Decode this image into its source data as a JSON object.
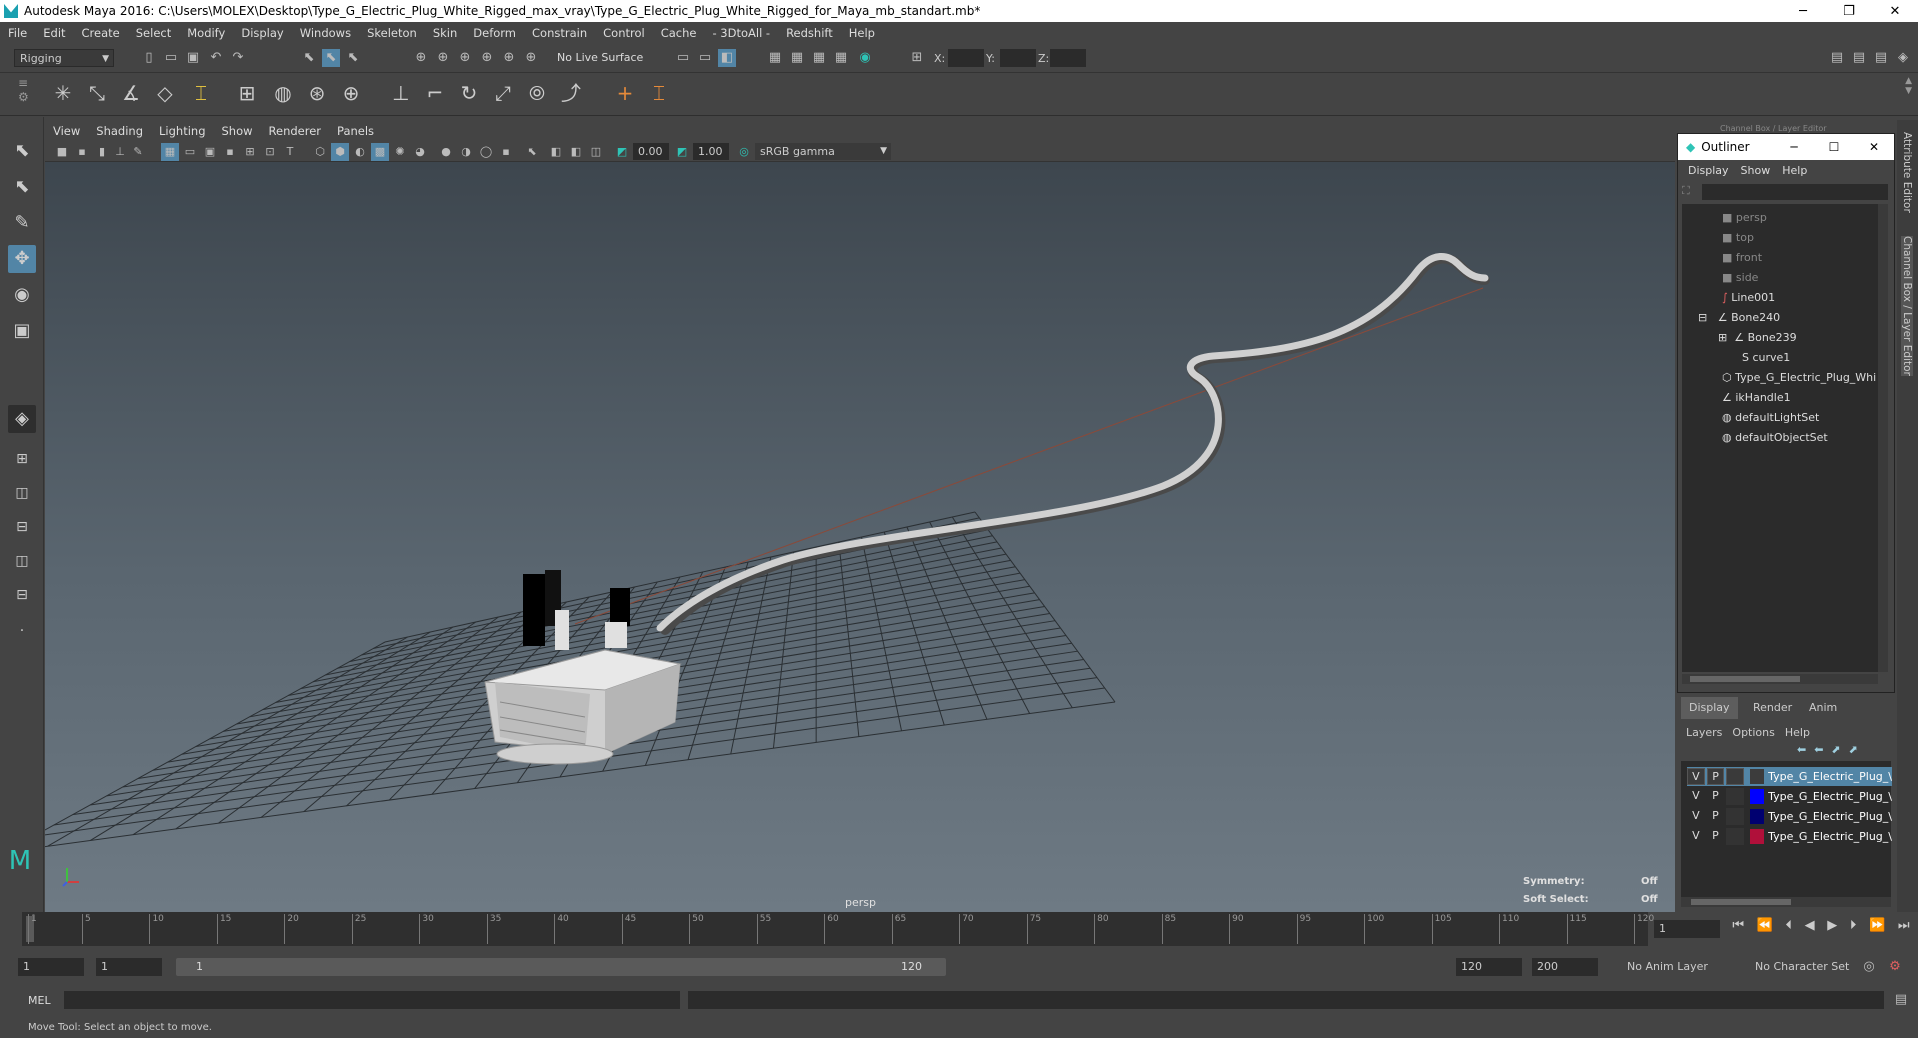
{
  "window": {
    "title": "Autodesk Maya 2016: C:\\Users\\MOLEX\\Desktop\\Type_G_Electric_Plug_White_Rigged_max_vray\\Type_G_Electric_Plug_White_Rigged_for_Maya_mb_standart.mb*",
    "minimize": "─",
    "restore": "❐",
    "close": "✕"
  },
  "menubar": [
    "File",
    "Edit",
    "Create",
    "Select",
    "Modify",
    "Display",
    "Windows",
    "Skeleton",
    "Skin",
    "Deform",
    "Constrain",
    "Control",
    "Cache",
    "- 3DtoAll -",
    "Redshift",
    "Help"
  ],
  "status_line": {
    "mode": "Rigging",
    "live_surface": "No Live Surface",
    "x_label": "X:",
    "y_label": "Y:",
    "z_label": "Z:"
  },
  "viewport": {
    "menu": [
      "View",
      "Shading",
      "Lighting",
      "Show",
      "Renderer",
      "Panels"
    ],
    "exposure": "0.00",
    "gamma": "1.00",
    "color_space": "sRGB gamma",
    "camera_label": "persp",
    "symmetry_label": "Symmetry:",
    "symmetry_value": "Off",
    "soft_select_label": "Soft Select:",
    "soft_select_value": "Off"
  },
  "channel_box_title": "Channel Box / Layer Editor",
  "outliner": {
    "title": "Outliner",
    "menu": [
      "Display",
      "Show",
      "Help"
    ],
    "items": [
      {
        "label": "persp",
        "dim": true
      },
      {
        "label": "top",
        "dim": true
      },
      {
        "label": "front",
        "dim": true
      },
      {
        "label": "side",
        "dim": true
      },
      {
        "label": "Line001",
        "dim": false
      },
      {
        "label": "Bone240",
        "dim": false
      },
      {
        "label": "Bone239",
        "dim": false
      },
      {
        "label": "curve1",
        "dim": false
      },
      {
        "label": "Type_G_Electric_Plug_Whi",
        "dim": false
      },
      {
        "label": "ikHandle1",
        "dim": false
      },
      {
        "label": "defaultLightSet",
        "dim": false
      },
      {
        "label": "defaultObjectSet",
        "dim": false
      }
    ]
  },
  "layer_editor": {
    "tabs": [
      "Display",
      "Render",
      "Anim"
    ],
    "menu": [
      "Layers",
      "Options",
      "Help"
    ],
    "layers": [
      {
        "v": "V",
        "p": "P",
        "name": "Type_G_Electric_Plug_\\",
        "color": "#3c3c3c"
      },
      {
        "v": "V",
        "p": "P",
        "name": "Type_G_Electric_Plug_\\",
        "color": "#0000ff"
      },
      {
        "v": "V",
        "p": "P",
        "name": "Type_G_Electric_Plug_\\",
        "color": "#000070"
      },
      {
        "v": "V",
        "p": "P",
        "name": "Type_G_Electric_Plug_\\",
        "color": "#b0103a"
      }
    ]
  },
  "side_tabs": [
    "Attribute Editor",
    "Channel Box / Layer Editor"
  ],
  "timeline": {
    "ticks": [
      "1",
      "5",
      "10",
      "15",
      "20",
      "25",
      "30",
      "35",
      "40",
      "45",
      "50",
      "55",
      "60",
      "65",
      "70",
      "75",
      "80",
      "85",
      "90",
      "95",
      "100",
      "105",
      "110",
      "115",
      "120"
    ],
    "current_frame": "1"
  },
  "range": {
    "start": "1",
    "playback_start": "1",
    "slider_start": "1",
    "slider_end": "120",
    "playback_end": "120",
    "end": "200",
    "anim_layer": "No Anim Layer",
    "character_set": "No Character Set"
  },
  "command_line": {
    "lang": "MEL"
  },
  "help_line": "Move Tool: Select an object to move."
}
